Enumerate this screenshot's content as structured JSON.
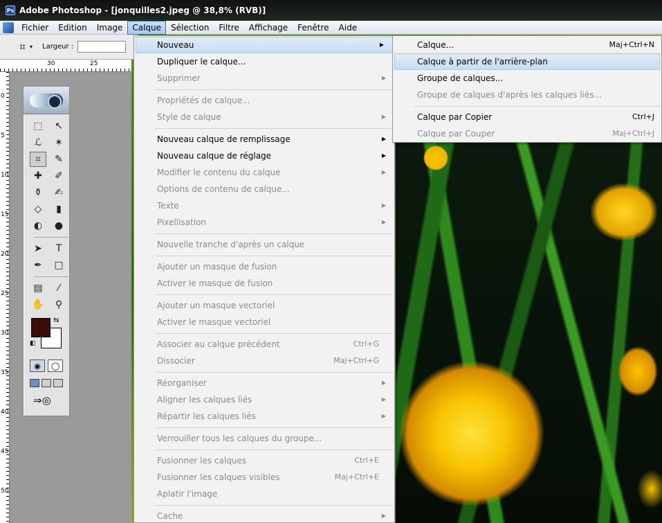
{
  "window": {
    "title": "Adobe Photoshop - [jonquilles2.jpeg @ 38,8% (RVB)]",
    "app_icon_label": "Ps"
  },
  "menubar": {
    "items": [
      "Fichier",
      "Edition",
      "Image",
      "Calque",
      "Sélection",
      "Filtre",
      "Affichage",
      "Fenêtre",
      "Aide"
    ],
    "active": "Calque"
  },
  "options_bar": {
    "crop_glyph": "⌗",
    "dropdown_glyph": "▾",
    "width_label": "Largeur :",
    "width_value": ""
  },
  "ruler": {
    "horizontal_ticks": [
      "30",
      "25"
    ],
    "vertical_ticks": [
      "0",
      "5",
      "10",
      "15",
      "20",
      "25",
      "30",
      "35",
      "40",
      "45",
      "50"
    ]
  },
  "toolbox": {
    "tools": [
      {
        "name": "marquee-tool-icon",
        "glyph": "⬚"
      },
      {
        "name": "move-tool-icon",
        "glyph": "↖"
      },
      {
        "name": "lasso-tool-icon",
        "glyph": "ℒ"
      },
      {
        "name": "magic-wand-tool-icon",
        "glyph": "✶"
      },
      {
        "name": "crop-tool-icon",
        "glyph": "⌗"
      },
      {
        "name": "slice-tool-icon",
        "glyph": "✎"
      },
      {
        "name": "healing-brush-tool-icon",
        "glyph": "✚"
      },
      {
        "name": "brush-tool-icon",
        "glyph": "✐"
      },
      {
        "name": "clone-stamp-tool-icon",
        "glyph": "⚱"
      },
      {
        "name": "history-brush-tool-icon",
        "glyph": "✍"
      },
      {
        "name": "eraser-tool-icon",
        "glyph": "◇"
      },
      {
        "name": "gradient-tool-icon",
        "glyph": "▮"
      },
      {
        "name": "blur-tool-icon",
        "glyph": "◐"
      },
      {
        "name": "dodge-tool-icon",
        "glyph": "●"
      },
      {
        "name": "path-selection-tool-icon",
        "glyph": "➤"
      },
      {
        "name": "type-tool-icon",
        "glyph": "T"
      },
      {
        "name": "pen-tool-icon",
        "glyph": "✒"
      },
      {
        "name": "shape-tool-icon",
        "glyph": "□"
      },
      {
        "name": "notes-tool-icon",
        "glyph": "▤"
      },
      {
        "name": "eyedropper-tool-icon",
        "glyph": "⁄"
      },
      {
        "name": "hand-tool-icon",
        "glyph": "✋"
      },
      {
        "name": "zoom-tool-icon",
        "glyph": "⚲"
      }
    ],
    "selected_tool": "crop-tool-icon",
    "foreground_color": "#3a0f0a",
    "background_color": "#ffffff",
    "swap_glyph": "⇆",
    "default_glyph": "◧",
    "quickmask_glyph": "◯",
    "standard_mode_glyph": "◉",
    "jump_glyph": "⇒◎"
  },
  "calque_menu": {
    "items": [
      {
        "label": "Nouveau",
        "shortcut": "",
        "submenu": true,
        "enabled": true,
        "hover": true
      },
      {
        "label": "Dupliquer le calque...",
        "shortcut": "",
        "submenu": false,
        "enabled": true
      },
      {
        "label": "Supprimer",
        "shortcut": "",
        "submenu": true,
        "enabled": false
      },
      {
        "sep": true
      },
      {
        "label": "Propriétés de calque...",
        "shortcut": "",
        "submenu": false,
        "enabled": false
      },
      {
        "label": "Style de calque",
        "shortcut": "",
        "submenu": true,
        "enabled": false
      },
      {
        "sep": true
      },
      {
        "label": "Nouveau calque de remplissage",
        "shortcut": "",
        "submenu": true,
        "enabled": true
      },
      {
        "label": "Nouveau calque de réglage",
        "shortcut": "",
        "submenu": true,
        "enabled": true
      },
      {
        "label": "Modifier le contenu du calque",
        "shortcut": "",
        "submenu": true,
        "enabled": false
      },
      {
        "label": "Options de contenu de calque...",
        "shortcut": "",
        "submenu": false,
        "enabled": false
      },
      {
        "label": "Texte",
        "shortcut": "",
        "submenu": true,
        "enabled": false
      },
      {
        "label": "Pixellisation",
        "shortcut": "",
        "submenu": true,
        "enabled": false
      },
      {
        "sep": true
      },
      {
        "label": "Nouvelle tranche d'après un calque",
        "shortcut": "",
        "submenu": false,
        "enabled": false
      },
      {
        "sep": true
      },
      {
        "label": "Ajouter un masque de fusion",
        "shortcut": "",
        "submenu": false,
        "enabled": false
      },
      {
        "label": "Activer le masque de fusion",
        "shortcut": "",
        "submenu": false,
        "enabled": false
      },
      {
        "sep": true
      },
      {
        "label": "Ajouter un masque vectoriel",
        "shortcut": "",
        "submenu": false,
        "enabled": false
      },
      {
        "label": "Activer le masque vectoriel",
        "shortcut": "",
        "submenu": false,
        "enabled": false
      },
      {
        "sep": true
      },
      {
        "label": "Associer au calque précédent",
        "shortcut": "Ctrl+G",
        "submenu": false,
        "enabled": false
      },
      {
        "label": "Dissocier",
        "shortcut": "Maj+Ctrl+G",
        "submenu": false,
        "enabled": false
      },
      {
        "sep": true
      },
      {
        "label": "Réorganiser",
        "shortcut": "",
        "submenu": true,
        "enabled": false
      },
      {
        "label": "Aligner les calques liés",
        "shortcut": "",
        "submenu": true,
        "enabled": false
      },
      {
        "label": "Répartir les calques liés",
        "shortcut": "",
        "submenu": true,
        "enabled": false
      },
      {
        "sep": true
      },
      {
        "label": "Verrouiller tous les calques du groupe...",
        "shortcut": "",
        "submenu": false,
        "enabled": false
      },
      {
        "sep": true
      },
      {
        "label": "Fusionner les calques",
        "shortcut": "Ctrl+E",
        "submenu": false,
        "enabled": false
      },
      {
        "label": "Fusionner les calques visibles",
        "shortcut": "Maj+Ctrl+E",
        "submenu": false,
        "enabled": false
      },
      {
        "label": "Aplatir l'image",
        "shortcut": "",
        "submenu": false,
        "enabled": false
      },
      {
        "sep": true
      },
      {
        "label": "Cache",
        "shortcut": "",
        "submenu": true,
        "enabled": false
      }
    ]
  },
  "nouveau_submenu": {
    "items": [
      {
        "label": "Calque...",
        "shortcut": "Maj+Ctrl+N",
        "enabled": true
      },
      {
        "label": "Calque à partir de l'arrière-plan",
        "shortcut": "",
        "enabled": true,
        "hover": true
      },
      {
        "label": "Groupe de calques...",
        "shortcut": "",
        "enabled": true
      },
      {
        "label": "Groupe de calques d'après les calques liés...",
        "shortcut": "",
        "enabled": false
      },
      {
        "sep": true
      },
      {
        "label": "Calque par Copier",
        "shortcut": "Ctrl+J",
        "enabled": true
      },
      {
        "label": "Calque par Couper",
        "shortcut": "Maj+Ctrl+J",
        "enabled": false
      }
    ]
  },
  "arrow_glyph": "▶"
}
